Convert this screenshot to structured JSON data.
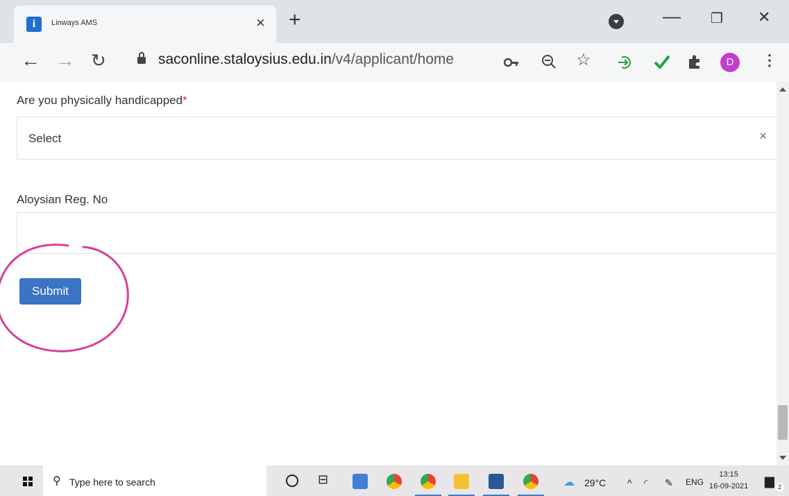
{
  "browser": {
    "tab_title": "Linways AMS",
    "tab_close": "×",
    "new_tab": "+",
    "favicon_letter": "i",
    "window_minimize": "—",
    "window_restore": "❐",
    "window_close": "✕",
    "url_domain": "saconline.staloysius.edu.in",
    "url_path": "/v4/applicant/home",
    "profile_initial": "D",
    "profile_color": "#c43bcf"
  },
  "form": {
    "handicapped_label": "Are you physically handicapped",
    "required_mark": "*",
    "handicapped_select_value": "Select",
    "clear_icon": "×",
    "reg_no_label": "Aloysian Reg. No",
    "reg_no_value": "",
    "submit_label": "Submit",
    "submit_color": "#3b73c5",
    "annotation_color": "#d93f9b"
  },
  "taskbar": {
    "search_placeholder": "Type here to search",
    "temperature": "29°C",
    "language": "ENG",
    "time": "13:15",
    "date": "16-09-2021",
    "notification_count": "2"
  }
}
